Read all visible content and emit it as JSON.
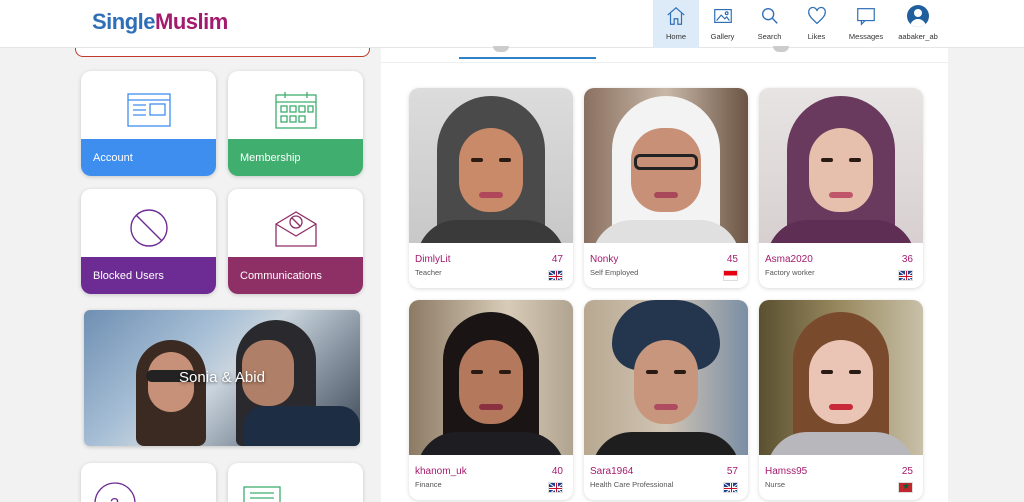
{
  "brand": {
    "part1": "Single",
    "part2": "Muslim"
  },
  "nav": [
    {
      "label": "Home",
      "icon": "home-icon",
      "active": true
    },
    {
      "label": "Gallery",
      "icon": "gallery-icon"
    },
    {
      "label": "Search",
      "icon": "search-icon"
    },
    {
      "label": "Likes",
      "icon": "heart-icon"
    },
    {
      "label": "Messages",
      "icon": "messages-icon"
    },
    {
      "label": "aabaker_ab",
      "icon": "avatar"
    }
  ],
  "tiles": [
    {
      "label": "Account",
      "color": "#3e8ef0",
      "icon": "account-icon"
    },
    {
      "label": "Membership",
      "color": "#3fae6e",
      "icon": "calendar-icon"
    },
    {
      "label": "Blocked Users",
      "color": "#6d2c93",
      "icon": "blocked-icon"
    },
    {
      "label": "Communications",
      "color": "#8e2f66",
      "icon": "envelope-icon"
    }
  ],
  "banner": {
    "label": "Sonia & Abid"
  },
  "profiles": [
    {
      "name": "DimlyLit",
      "age": "47",
      "job": "Teacher",
      "flag": "uk"
    },
    {
      "name": "Nonky",
      "age": "45",
      "job": "Self Employed",
      "flag": "id"
    },
    {
      "name": "Asma2020",
      "age": "36",
      "job": "Factory worker",
      "flag": "uk"
    },
    {
      "name": "khanom_uk",
      "age": "40",
      "job": "Finance",
      "flag": "uk"
    },
    {
      "name": "Sara1964",
      "age": "57",
      "job": "Health Care Professional",
      "flag": "uk"
    },
    {
      "name": "Hamss95",
      "age": "25",
      "job": "Nurse",
      "flag": "ma"
    }
  ]
}
